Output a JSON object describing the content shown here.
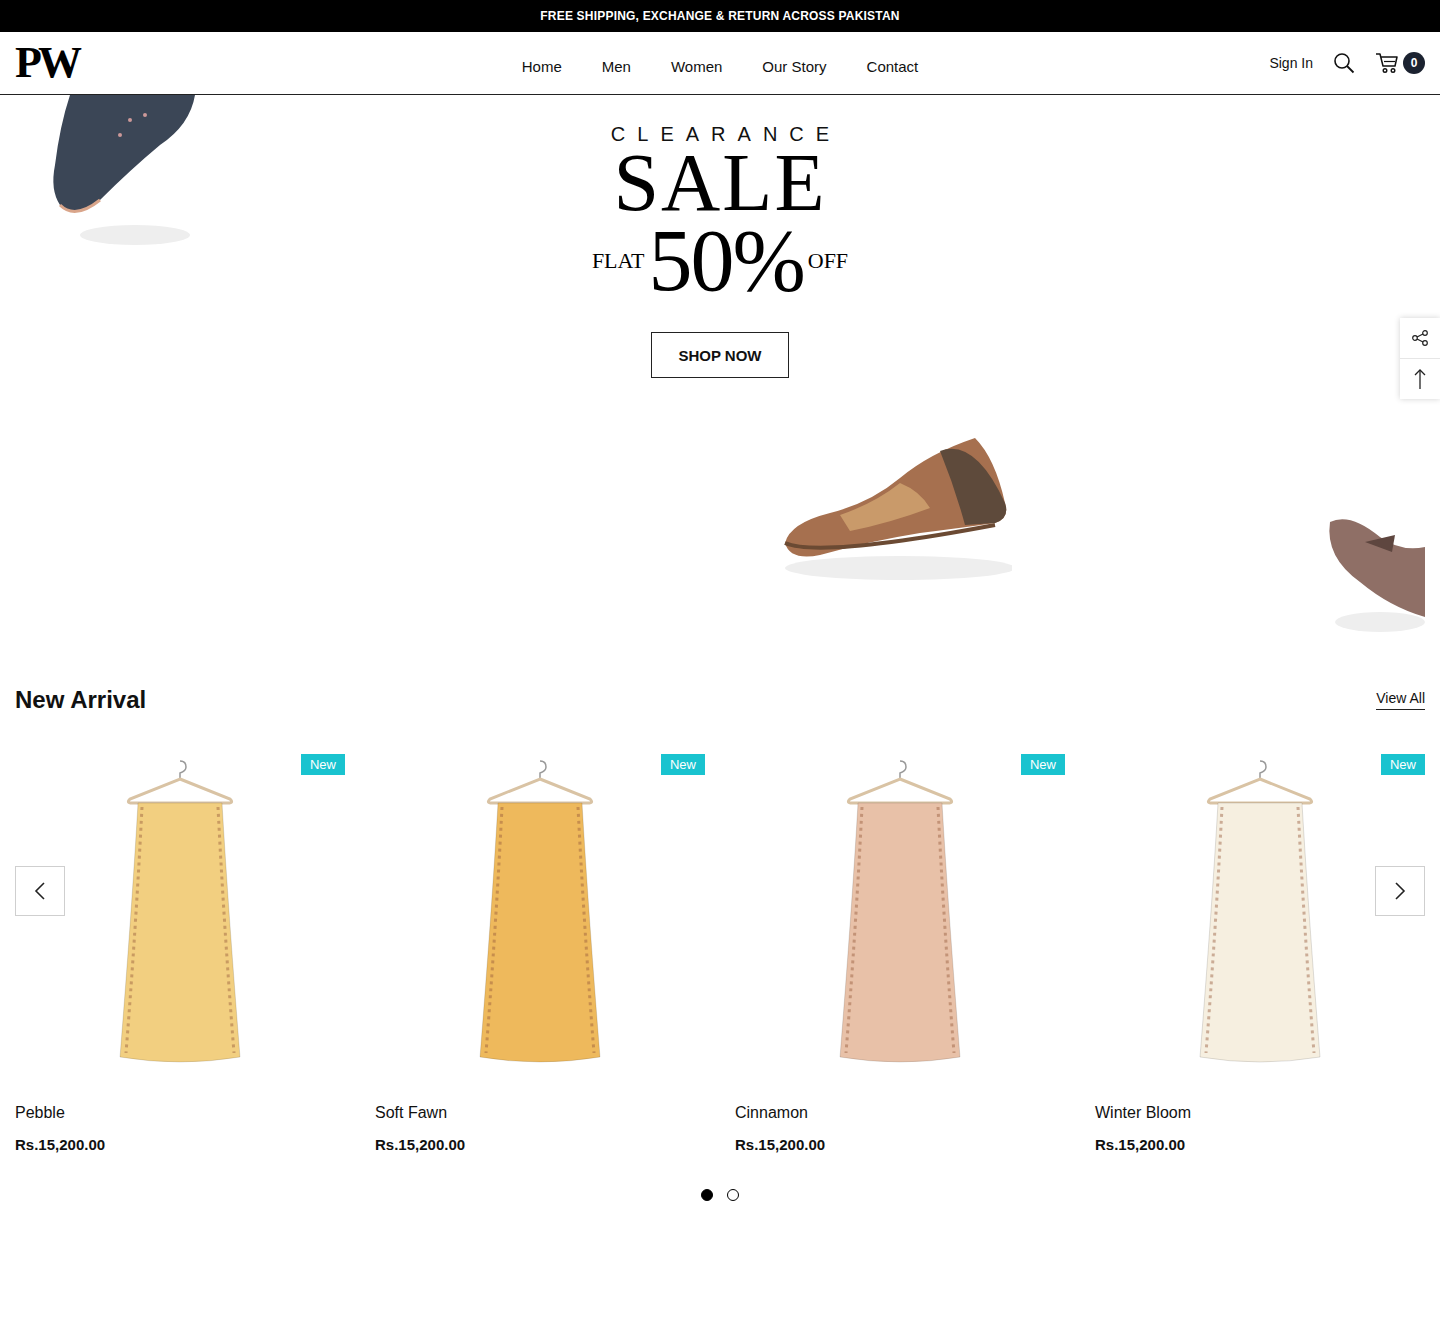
{
  "announcement": "FREE SHIPPING, EXCHANGE & RETURN ACROSS PAKISTAN",
  "logo": "PW",
  "nav": [
    {
      "label": "Home"
    },
    {
      "label": "Men"
    },
    {
      "label": "Women"
    },
    {
      "label": "Our Story"
    },
    {
      "label": "Contact"
    }
  ],
  "header_actions": {
    "sign_in": "Sign In",
    "cart_count": "0"
  },
  "hero": {
    "clearance": "CLEARANCE",
    "sale": "SALE",
    "flat": "FLAT",
    "discount": "50%",
    "off": "OFF",
    "button": "SHOP NOW"
  },
  "new_arrival": {
    "title": "New Arrival",
    "view_all": "View All",
    "products": [
      {
        "name": "Pebble",
        "price": "Rs.15,200.00",
        "badge": "New",
        "color": "#f2cf80"
      },
      {
        "name": "Soft Fawn",
        "price": "Rs.15,200.00",
        "badge": "New",
        "color": "#eeb95c"
      },
      {
        "name": "Cinnamon",
        "price": "Rs.15,200.00",
        "badge": "New",
        "color": "#e8c1a8"
      },
      {
        "name": "Winter Bloom",
        "price": "Rs.15,200.00",
        "badge": "New",
        "color": "#f6efe0"
      }
    ],
    "pages": [
      {
        "selected": true
      },
      {
        "selected": false
      }
    ]
  }
}
